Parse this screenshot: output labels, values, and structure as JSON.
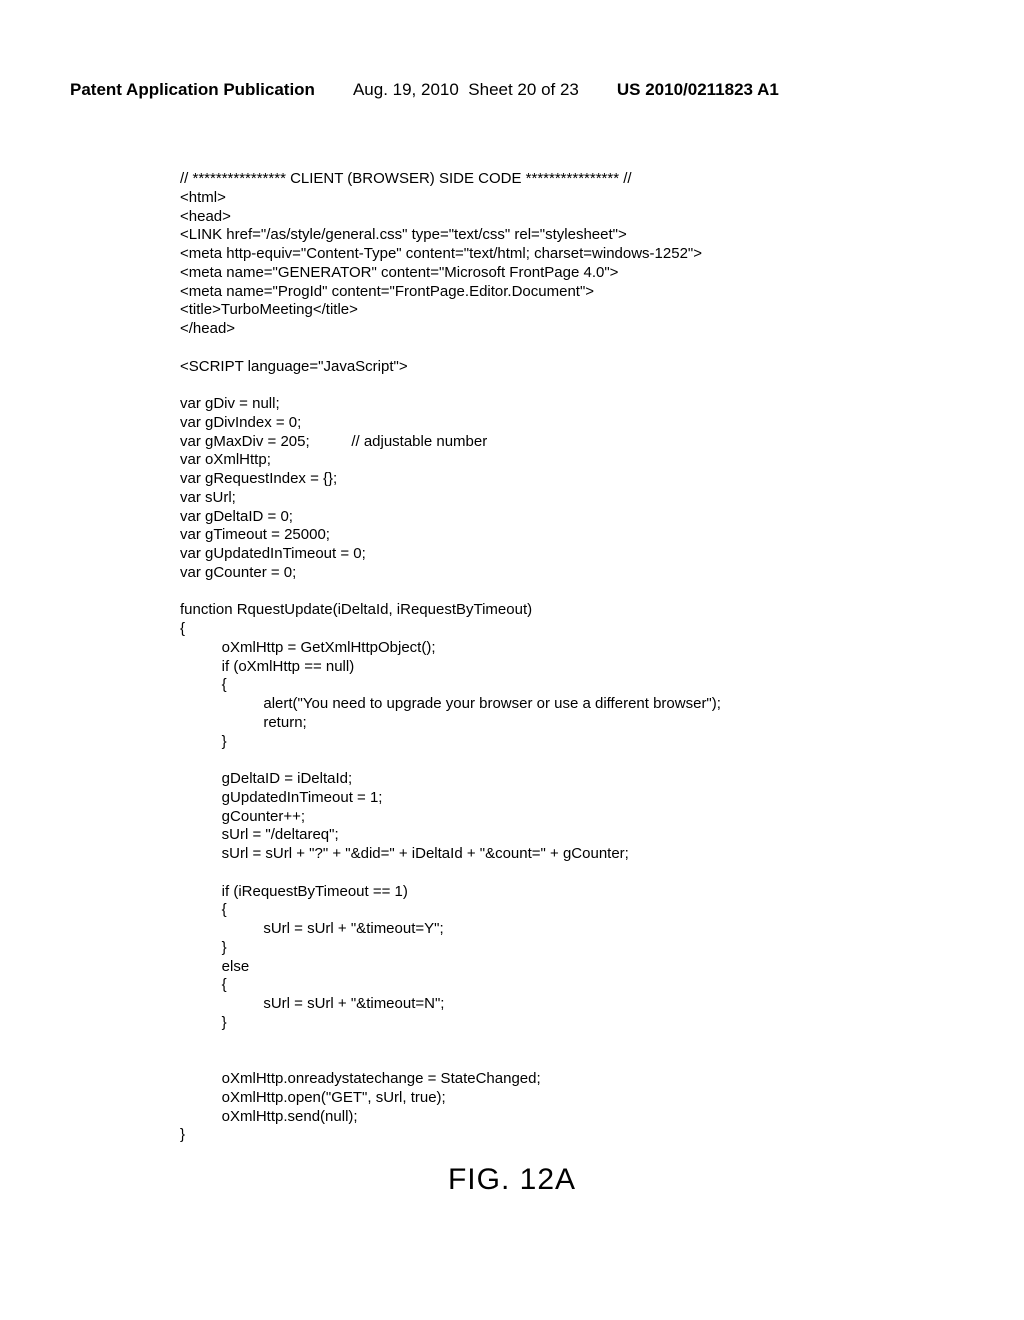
{
  "header": {
    "publication": "Patent Application Publication",
    "date": "Aug. 19, 2010",
    "sheet": "Sheet 20 of 23",
    "patent_number": "US 2010/0211823 A1"
  },
  "code": "// **************** CLIENT (BROWSER) SIDE CODE **************** //\n<html>\n<head>\n<LINK href=\"/as/style/general.css\" type=\"text/css\" rel=\"stylesheet\">\n<meta http-equiv=\"Content-Type\" content=\"text/html; charset=windows-1252\">\n<meta name=\"GENERATOR\" content=\"Microsoft FrontPage 4.0\">\n<meta name=\"ProgId\" content=\"FrontPage.Editor.Document\">\n<title>TurboMeeting</title>\n</head>\n\n<SCRIPT language=\"JavaScript\">\n\nvar gDiv = null;\nvar gDivIndex = 0;\nvar gMaxDiv = 205;          // adjustable number\nvar oXmlHttp;\nvar gRequestIndex = {};\nvar sUrl;\nvar gDeltaID = 0;\nvar gTimeout = 25000;\nvar gUpdatedInTimeout = 0;\nvar gCounter = 0;\n\nfunction RquestUpdate(iDeltaId, iRequestByTimeout)\n{\n          oXmlHttp = GetXmlHttpObject();\n          if (oXmlHttp == null)\n          {\n                    alert(\"You need to upgrade your browser or use a different browser\");\n                    return;\n          }\n\n          gDeltaID = iDeltaId;\n          gUpdatedInTimeout = 1;\n          gCounter++;\n          sUrl = \"/deltareq\";\n          sUrl = sUrl + \"?\" + \"&did=\" + iDeltaId + \"&count=\" + gCounter;\n\n          if (iRequestByTimeout == 1)\n          {\n                    sUrl = sUrl + \"&timeout=Y\";\n          }\n          else\n          {\n                    sUrl = sUrl + \"&timeout=N\";\n          }\n\n\n          oXmlHttp.onreadystatechange = StateChanged;\n          oXmlHttp.open(\"GET\", sUrl, true);\n          oXmlHttp.send(null);\n}",
  "figure_label": "FIG. 12A"
}
